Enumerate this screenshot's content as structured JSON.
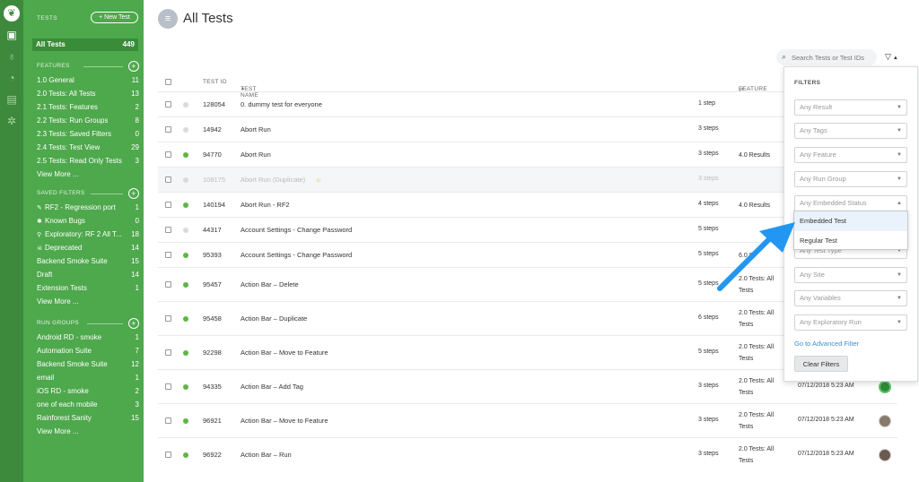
{
  "sidebar": {
    "header": "TESTS",
    "new_test_label": "+ New Test",
    "all_tests": {
      "label": "All Tests",
      "count": "449"
    },
    "features": {
      "header": "FEATURES",
      "items": [
        {
          "label": "1.0 General",
          "count": "11"
        },
        {
          "label": "2.0 Tests: All Tests",
          "count": "13"
        },
        {
          "label": "2.1 Tests: Features",
          "count": "2"
        },
        {
          "label": "2.2 Tests: Run Groups",
          "count": "8"
        },
        {
          "label": "2.3 Tests: Saved Filters",
          "count": "0"
        },
        {
          "label": "2.4 Tests: Test View",
          "count": "29"
        },
        {
          "label": "2.5 Tests: Read Only Tests",
          "count": "3"
        }
      ],
      "view_more": "View More ..."
    },
    "saved_filters": {
      "header": "SAVED FILTERS",
      "items": [
        {
          "icon": "pencil-icon",
          "label": "RF2 - Regression port",
          "count": "1"
        },
        {
          "icon": "bug-icon",
          "label": "Known Bugs",
          "count": "0"
        },
        {
          "icon": "magnifier-icon",
          "label": "Exploratory: RF 2 All T...",
          "count": "18"
        },
        {
          "icon": "skull-icon",
          "label": "Deprecated",
          "count": "14"
        },
        {
          "icon": "",
          "label": "Backend Smoke Suite",
          "count": "15"
        },
        {
          "icon": "",
          "label": "Draft",
          "count": "14"
        },
        {
          "icon": "",
          "label": "Extension Tests",
          "count": "1"
        }
      ],
      "view_more": "View More ..."
    },
    "run_groups": {
      "header": "RUN GROUPS",
      "items": [
        {
          "label": "Android RD - smoke",
          "count": "1"
        },
        {
          "label": "Automation Suite",
          "count": "7"
        },
        {
          "label": "Backend Smoke Suite",
          "count": "12"
        },
        {
          "label": "email",
          "count": "1"
        },
        {
          "label": "iOS RD - smoke",
          "count": "2"
        },
        {
          "label": "one of each mobile",
          "count": "3"
        },
        {
          "label": "Rainforest Sanity",
          "count": "15"
        }
      ],
      "view_more": "View More ..."
    }
  },
  "header": {
    "title": "All Tests"
  },
  "search": {
    "placeholder": "Search Tests or Test IDs"
  },
  "table": {
    "columns": {
      "test_id": "TEST ID",
      "test_name": "TEST NAME",
      "feature": "FEATURE"
    },
    "rows": [
      {
        "status": "grey",
        "id": "128054",
        "name": "0. dummy test for everyone",
        "steps": "1 step",
        "feature": "",
        "date": "",
        "avatar": ""
      },
      {
        "status": "grey",
        "id": "14942",
        "name": "Abort Run",
        "steps": "3 steps",
        "feature": "",
        "date": "",
        "avatar": ""
      },
      {
        "status": "green",
        "id": "94770",
        "name": "Abort Run",
        "steps": "3 steps",
        "feature": "4.0 Results",
        "date": "",
        "avatar": ""
      },
      {
        "status": "grey",
        "id": "108175",
        "name": "Abort Run (Duplicate)",
        "steps": "3 steps",
        "feature": "",
        "date": "",
        "avatar": "",
        "duplicate": true
      },
      {
        "status": "green",
        "id": "140194",
        "name": "Abort Run - RF2",
        "steps": "4 steps",
        "feature": "4.0 Results",
        "date": "",
        "avatar": ""
      },
      {
        "status": "grey",
        "id": "44317",
        "name": "Account Settings - Change Password",
        "steps": "5 steps",
        "feature": "",
        "date": "",
        "avatar": ""
      },
      {
        "status": "green",
        "id": "95393",
        "name": "Account Settings - Change Password",
        "steps": "5 steps",
        "feature": "6.0 S",
        "date": "",
        "avatar": ""
      },
      {
        "status": "green",
        "id": "95457",
        "name": "Action Bar – Delete",
        "steps": "5 steps",
        "feature": "2.0 Tests: All Tests",
        "date": "",
        "avatar": ""
      },
      {
        "status": "green",
        "id": "95458",
        "name": "Action Bar – Duplicate",
        "steps": "6 steps",
        "feature": "2.0 Tests: All Tests",
        "date": "",
        "avatar": ""
      },
      {
        "status": "green",
        "id": "92298",
        "name": "Action Bar – Move to Feature",
        "steps": "5 steps",
        "feature": "2.0 Tests: All Tests",
        "date": "",
        "avatar": ""
      },
      {
        "status": "green",
        "id": "94335",
        "name": "Action Bar – Add Tag",
        "steps": "3 steps",
        "feature": "2.0 Tests: All Tests",
        "date": "07/12/2018 5:23 AM",
        "avatar": "a1"
      },
      {
        "status": "green",
        "id": "96921",
        "name": "Action Bar – Move to Feature",
        "steps": "3 steps",
        "feature": "2.0 Tests: All Tests",
        "date": "07/12/2018 5:23 AM",
        "avatar": "a2"
      },
      {
        "status": "green",
        "id": "96922",
        "name": "Action Bar – Run",
        "steps": "3 steps",
        "feature": "2.0 Tests: All Tests",
        "date": "07/12/2018 5:23 AM",
        "avatar": "a3"
      }
    ]
  },
  "filters": {
    "title": "FILTERS",
    "selects": [
      "Any Result",
      "Any Tags",
      "Any Feature",
      "Any Run Group",
      "Any Embedded Status",
      "Any Test Type",
      "Any Site",
      "Any Variables",
      "Any Exploratory Run"
    ],
    "dropdown_options": [
      "Embedded Test",
      "Regular Test"
    ],
    "advanced_link": "Go to Advanced Filter",
    "clear_button": "Clear Filters"
  },
  "colors": {
    "sidebar": "#4ea84c",
    "rail": "#3e8a3c",
    "arrow": "#2196f3",
    "link": "#3b8fd0",
    "status_green": "#5fb545"
  }
}
